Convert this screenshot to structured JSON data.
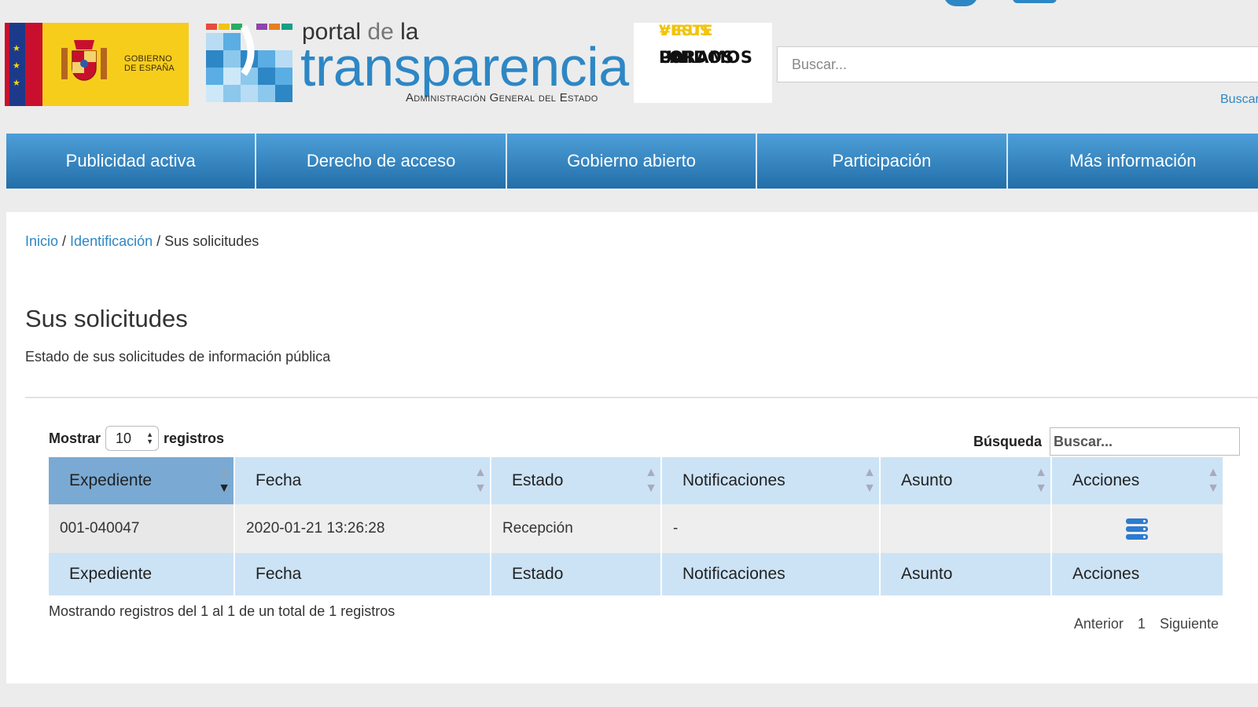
{
  "header": {
    "gov_logo_text_1": "GOBIERNO",
    "gov_logo_text_2": "DE ESPAÑA",
    "portal_text": "portal",
    "de_text": "de",
    "la_text": "la",
    "transparencia_text": "transparencia",
    "admin_text": "Administración General del Estado",
    "virus_line_1": "#ESTE",
    "virus_line_2": "VIRUS",
    "virus_line_3": "LO",
    "virus_line_4": "PARAMOS",
    "virus_line_5": "UNIDOS",
    "search_placeholder": "Buscar...",
    "search_link": "Buscar"
  },
  "nav": {
    "items": [
      {
        "label": "Publicidad activa"
      },
      {
        "label": "Derecho de acceso"
      },
      {
        "label": "Gobierno abierto"
      },
      {
        "label": "Participación"
      },
      {
        "label": "Más información"
      }
    ]
  },
  "breadcrumb": {
    "home": "Inicio",
    "sep1": " / ",
    "ident": "Identificación",
    "sep2": " / ",
    "current": "Sus solicitudes"
  },
  "page": {
    "title": "Sus solicitudes",
    "subtitle": "Estado de sus solicitudes de información pública"
  },
  "table_controls": {
    "show_label": "Mostrar",
    "show_value": "10",
    "records_label": "registros",
    "search_label": "Búsqueda",
    "search_placeholder": "Buscar..."
  },
  "table": {
    "columns": [
      "Expediente",
      "Fecha",
      "Estado",
      "Notificaciones",
      "Asunto",
      "Acciones"
    ],
    "rows": [
      {
        "expediente": "001-040047",
        "fecha": "2020-01-21 13:26:28",
        "estado": "Recepción",
        "notificaciones": "-",
        "asunto": ""
      }
    ]
  },
  "footer": {
    "info": "Mostrando registros del 1 al 1 de un total de 1 registros",
    "prev": "Anterior",
    "page": "1",
    "next": "Siguiente"
  },
  "colors": {
    "brand_blue": "#2d87c5",
    "nav_top": "#4d9fd8",
    "nav_bottom": "#236ea9",
    "table_header": "#cce3f6",
    "table_header_sorted": "#7aaad3"
  }
}
